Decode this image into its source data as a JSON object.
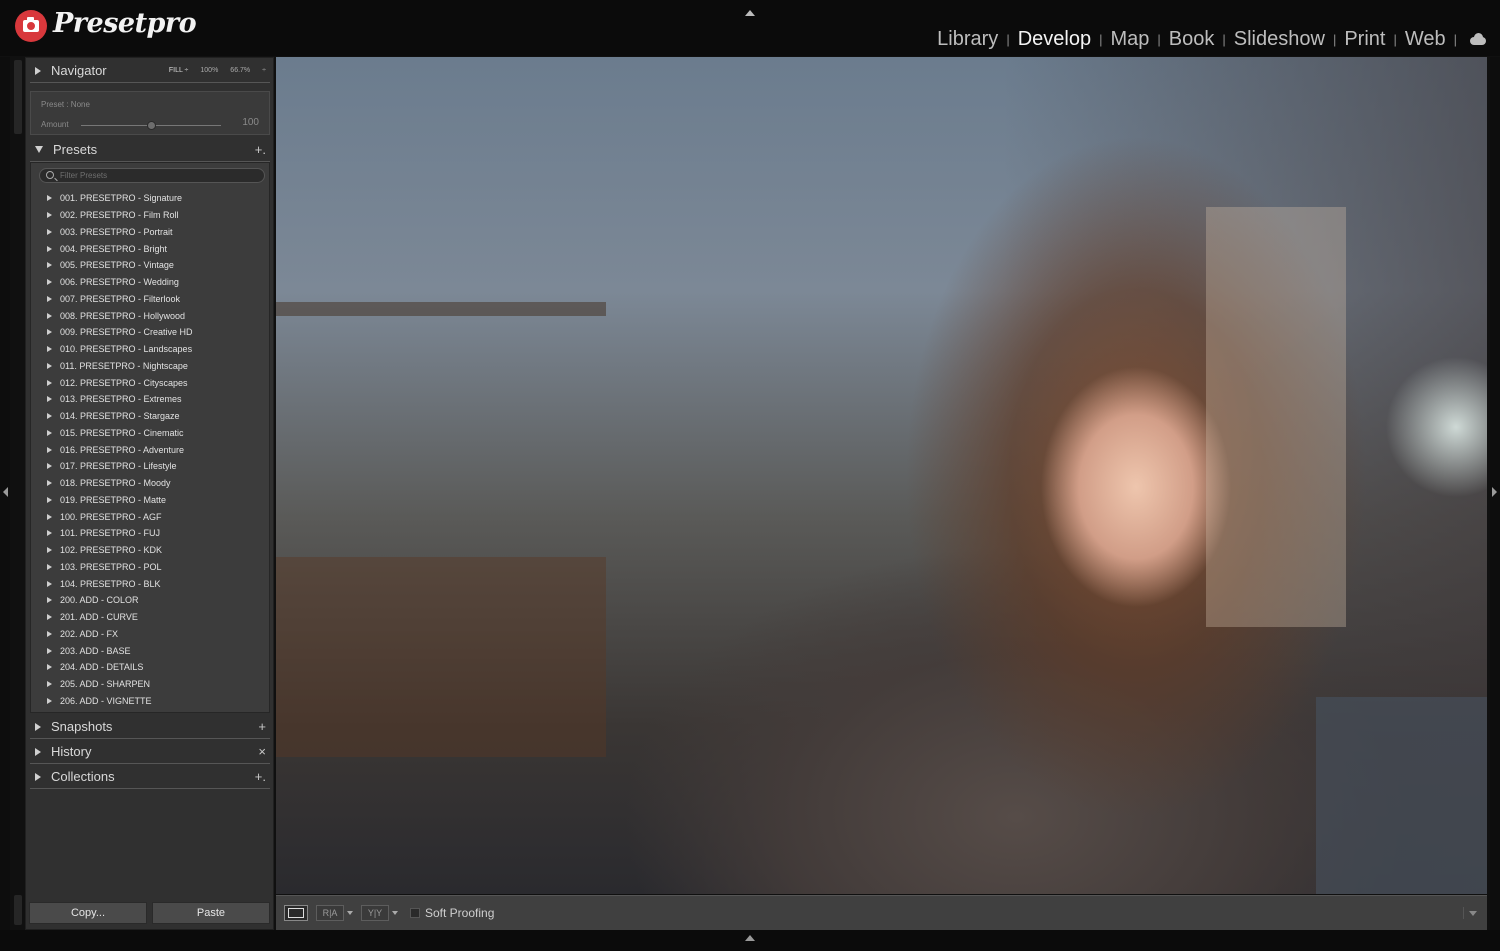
{
  "app": {
    "logo_text": "Presetpro"
  },
  "modules": [
    {
      "label": "Library",
      "active": false
    },
    {
      "label": "Develop",
      "active": true
    },
    {
      "label": "Map",
      "active": false
    },
    {
      "label": "Book",
      "active": false
    },
    {
      "label": "Slideshow",
      "active": false
    },
    {
      "label": "Print",
      "active": false
    },
    {
      "label": "Web",
      "active": false
    }
  ],
  "module_separator": "|",
  "navigator": {
    "title": "Navigator",
    "fill": "FILL ÷",
    "zoom_100": "100%",
    "zoom_667": "66.7%",
    "zoom_more": "÷"
  },
  "preset_box": {
    "preset_label": "Preset : None",
    "amount_label": "Amount",
    "amount_value": "100",
    "amount_fraction": 0.5
  },
  "presets": {
    "title": "Presets",
    "add": "+.",
    "filter_placeholder": "Filter Presets",
    "items": [
      "001. PRESETPRO - Signature",
      "002. PRESETPRO - Film Roll",
      "003. PRESETPRO - Portrait",
      "004. PRESETPRO - Bright",
      "005. PRESETPRO - Vintage",
      "006. PRESETPRO - Wedding",
      "007. PRESETPRO - Filterlook",
      "008. PRESETPRO - Hollywood",
      "009. PRESETPRO - Creative HD",
      "010. PRESETPRO - Landscapes",
      "011. PRESETPRO - Nightscape",
      "012. PRESETPRO - Cityscapes",
      "013. PRESETPRO - Extremes",
      "014. PRESETPRO - Stargaze",
      "015. PRESETPRO - Cinematic",
      "016. PRESETPRO - Adventure",
      "017. PRESETPRO - Lifestyle",
      "018. PRESETPRO - Moody",
      "019. PRESETPRO - Matte",
      "100. PRESETPRO - AGF",
      "101. PRESETPRO - FUJ",
      "102. PRESETPRO - KDK",
      "103. PRESETPRO - POL",
      "104. PRESETPRO - BLK",
      "200. ADD - COLOR",
      "201. ADD - CURVE",
      "202. ADD - FX",
      "203. ADD - BASE",
      "204. ADD - DETAILS",
      "205. ADD - SHARPEN",
      "206. ADD - VIGNETTE"
    ]
  },
  "snapshots": {
    "title": "Snapshots",
    "action": "+"
  },
  "history": {
    "title": "History",
    "action": "×"
  },
  "collections": {
    "title": "Collections",
    "action": "+."
  },
  "buttons": {
    "copy": "Copy...",
    "paste": "Paste"
  },
  "toolbar": {
    "compare_glyph": "R|A",
    "yy_glyph": "Y|Y",
    "soft_proofing": "Soft Proofing"
  },
  "colors": {
    "accent_logo": "#d8383c",
    "panel_bg": "#303030"
  }
}
